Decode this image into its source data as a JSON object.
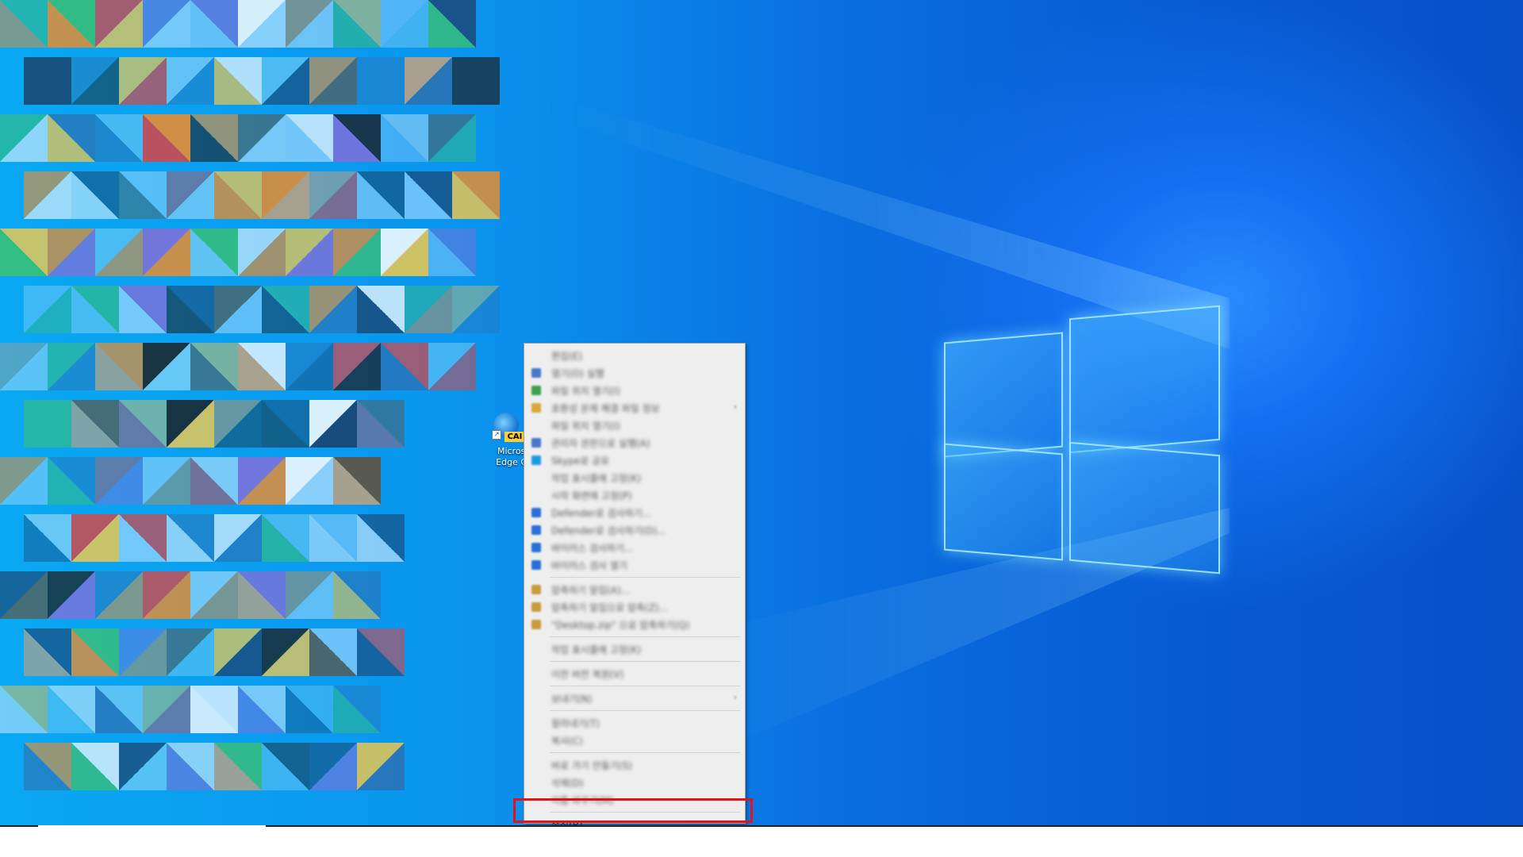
{
  "desktop": {
    "shortcut": {
      "badge": "CAI",
      "label_line1": "Microso",
      "label_line2": "Edge Ca",
      "icon": "edge-icon"
    }
  },
  "context_menu": {
    "items": [
      {
        "label": "편집(E)",
        "icon": null,
        "submenu": false
      },
      {
        "label": "열기(O) 실행",
        "icon": "shield-icon",
        "submenu": false
      },
      {
        "label": "파일 위치 열기(I)",
        "icon": "green-icon",
        "submenu": false
      },
      {
        "label": "호환성 문제 해결 파일 정보",
        "icon": "folder-icon",
        "submenu": true
      },
      {
        "label": "파일 위치 열기(I)",
        "icon": null,
        "submenu": false
      },
      {
        "label": "관리자 권한으로 실행(A)",
        "icon": "shield-icon",
        "submenu": false
      },
      {
        "label": "Skype로 공유",
        "icon": "skype-icon",
        "submenu": false
      },
      {
        "label": "작업 표시줄에 고정(K)",
        "icon": null,
        "submenu": false
      },
      {
        "label": "시작 화면에 고정(P)",
        "icon": null,
        "submenu": false
      },
      {
        "label": "Defender로 검사하기...",
        "icon": "defender-icon",
        "submenu": false
      },
      {
        "label": "Defender로 검사하기(D)...",
        "icon": "defender-icon",
        "submenu": false
      },
      {
        "label": "바이러스 검사하기...",
        "icon": "defender-icon",
        "submenu": false
      },
      {
        "label": "바이러스 검사 열기",
        "icon": "defender-icon",
        "submenu": false
      },
      {
        "sep": true
      },
      {
        "label": "압축하기 알집(A)...",
        "icon": "archive-icon",
        "submenu": false
      },
      {
        "label": "압축하기 알집으로 압축(Z)...",
        "icon": "archive-icon",
        "submenu": false
      },
      {
        "label": "\"Desktop.zip\" 으로 압축하기(Q)",
        "icon": "archive-icon",
        "submenu": false
      },
      {
        "sep": true
      },
      {
        "label": "작업 표시줄에 고정(K)",
        "icon": null,
        "submenu": false
      },
      {
        "sep": true
      },
      {
        "label": "이전 버전 복원(V)",
        "icon": null,
        "submenu": false
      },
      {
        "sep": true
      },
      {
        "label": "보내기(N)",
        "icon": null,
        "submenu": true
      },
      {
        "sep": true
      },
      {
        "label": "잘라내기(T)",
        "icon": null,
        "submenu": false
      },
      {
        "label": "복사(C)",
        "icon": null,
        "submenu": false
      },
      {
        "sep": true
      },
      {
        "label": "바로 가기 만들기(S)",
        "icon": null,
        "submenu": false
      },
      {
        "label": "삭제(D)",
        "icon": null,
        "submenu": false
      },
      {
        "label": "이름 바꾸기(M)",
        "icon": null,
        "submenu": false
      },
      {
        "sep": true
      },
      {
        "label": "속성(R)",
        "icon": null,
        "submenu": false,
        "focused": true
      }
    ]
  },
  "colors": {
    "highlight": "#e0141e",
    "menu_bg": "#eeeeee"
  }
}
